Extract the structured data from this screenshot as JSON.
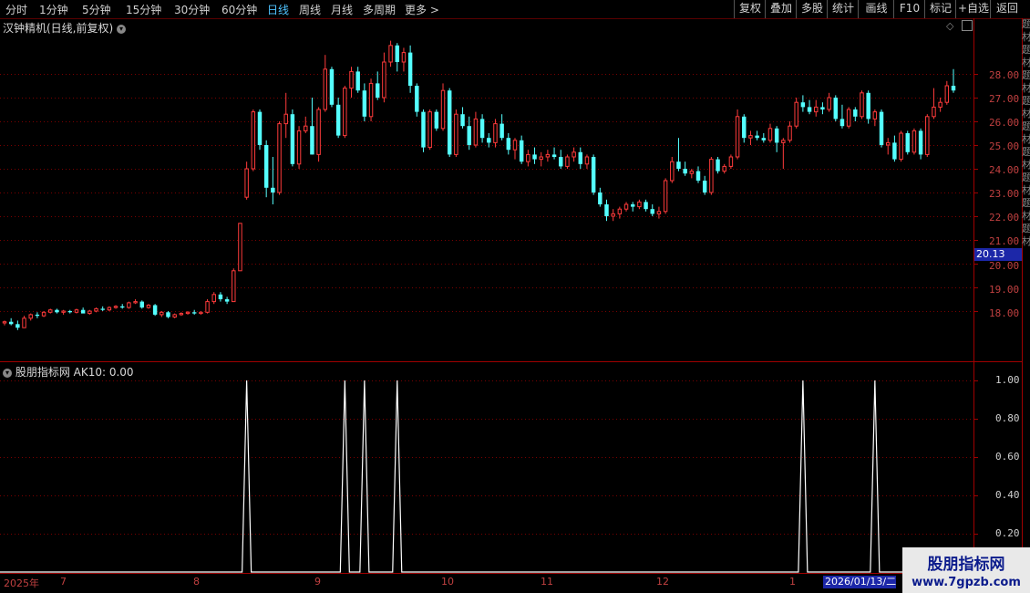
{
  "toolbar": {
    "periods": [
      "分时",
      "1分钟",
      "5分钟",
      "15分钟",
      "30分钟",
      "60分钟",
      "日线",
      "周线",
      "月线",
      "多周期",
      "更多 >"
    ],
    "active_period": "日线",
    "right_buttons": [
      "复权",
      "叠加",
      "多股",
      "统计",
      "画线",
      "F10",
      "标记",
      "+自选",
      "返回"
    ]
  },
  "main_title": "汉钟精机(日线,前复权)",
  "indicator_title": "股朋指标网  AK10: 0.00",
  "price_axis": [
    "28.00",
    "27.00",
    "26.00",
    "25.00",
    "24.00",
    "23.00",
    "22.00",
    "21.00",
    "20.00",
    "19.00",
    "18.00"
  ],
  "indicator_axis": [
    "1.00",
    "0.80",
    "0.60",
    "0.40",
    "0.20"
  ],
  "current_price": "20.13",
  "date_axis": [
    "2025年",
    "7",
    "8",
    "9",
    "10",
    "11",
    "12",
    "1"
  ],
  "cursor_date": "2026/01/13/二",
  "watermark": {
    "name": "股朋指标网",
    "url": "www.7gpzb.com"
  },
  "colors": {
    "up": "#ff3b3b",
    "down": "#54ffff",
    "grid": "#7a0000",
    "line": "#ffffff"
  },
  "side_text": "题材题材题材题材题材题材题材题材题材",
  "chart_data": {
    "type": "candlestick",
    "title": "汉钟精机(日线,前复权)",
    "candles_ohlc": [
      [
        17.5,
        17.6,
        17.4,
        17.55
      ],
      [
        17.55,
        17.7,
        17.4,
        17.45
      ],
      [
        17.45,
        17.6,
        17.2,
        17.3
      ],
      [
        17.3,
        17.8,
        17.3,
        17.7
      ],
      [
        17.7,
        17.9,
        17.6,
        17.85
      ],
      [
        17.85,
        17.95,
        17.7,
        17.8
      ],
      [
        17.8,
        18.0,
        17.75,
        17.95
      ],
      [
        17.95,
        18.1,
        17.9,
        18.05
      ],
      [
        18.05,
        18.1,
        17.9,
        17.95
      ],
      [
        17.95,
        18.05,
        17.85,
        18.0
      ],
      [
        18.0,
        18.05,
        17.9,
        17.95
      ],
      [
        17.95,
        18.1,
        17.9,
        18.05
      ],
      [
        18.05,
        18.15,
        17.95,
        17.9
      ],
      [
        17.9,
        18.05,
        17.85,
        18.0
      ],
      [
        18.0,
        18.15,
        17.95,
        18.1
      ],
      [
        18.1,
        18.2,
        18.0,
        18.05
      ],
      [
        18.05,
        18.2,
        18.0,
        18.15
      ],
      [
        18.15,
        18.25,
        18.1,
        18.2
      ],
      [
        18.2,
        18.3,
        18.1,
        18.15
      ],
      [
        18.15,
        18.4,
        18.1,
        18.35
      ],
      [
        18.35,
        18.5,
        18.3,
        18.4
      ],
      [
        18.4,
        18.45,
        18.1,
        18.15
      ],
      [
        18.15,
        18.3,
        18.1,
        18.25
      ],
      [
        18.25,
        18.3,
        17.8,
        17.85
      ],
      [
        17.85,
        18.0,
        17.75,
        17.95
      ],
      [
        17.95,
        18.0,
        17.7,
        17.75
      ],
      [
        17.75,
        17.9,
        17.7,
        17.85
      ],
      [
        17.85,
        17.95,
        17.8,
        17.9
      ],
      [
        17.9,
        18.0,
        17.85,
        17.95
      ],
      [
        17.95,
        18.05,
        17.85,
        17.9
      ],
      [
        17.9,
        18.0,
        17.85,
        17.95
      ],
      [
        17.95,
        18.5,
        17.9,
        18.4
      ],
      [
        18.4,
        18.8,
        18.3,
        18.7
      ],
      [
        18.7,
        18.8,
        18.4,
        18.5
      ],
      [
        18.5,
        18.6,
        18.3,
        18.4
      ],
      [
        18.4,
        19.8,
        18.4,
        19.7
      ],
      [
        19.7,
        21.7,
        19.7,
        21.7
      ],
      [
        22.8,
        24.3,
        22.7,
        24.0
      ],
      [
        24.0,
        26.5,
        23.9,
        26.4
      ],
      [
        26.4,
        26.5,
        24.8,
        25.0
      ],
      [
        25.0,
        25.2,
        22.8,
        23.2
      ],
      [
        23.2,
        24.5,
        22.5,
        23.0
      ],
      [
        23.0,
        26.0,
        22.9,
        25.9
      ],
      [
        25.9,
        27.2,
        25.3,
        26.3
      ],
      [
        26.3,
        26.5,
        24.1,
        24.2
      ],
      [
        24.2,
        25.8,
        24.0,
        25.6
      ],
      [
        25.6,
        26.2,
        25.5,
        25.8
      ],
      [
        25.8,
        27.0,
        24.6,
        24.6
      ],
      [
        24.6,
        26.6,
        24.3,
        26.5
      ],
      [
        26.5,
        28.8,
        26.4,
        28.2
      ],
      [
        28.2,
        28.3,
        26.6,
        26.7
      ],
      [
        26.7,
        27.0,
        25.3,
        25.4
      ],
      [
        25.4,
        27.5,
        25.3,
        27.4
      ],
      [
        27.4,
        28.3,
        27.0,
        28.1
      ],
      [
        28.1,
        28.3,
        27.2,
        27.3
      ],
      [
        27.3,
        27.6,
        26.0,
        26.2
      ],
      [
        26.2,
        27.8,
        26.0,
        27.6
      ],
      [
        27.6,
        28.1,
        26.9,
        27.0
      ],
      [
        27.0,
        28.9,
        26.8,
        28.5
      ],
      [
        28.5,
        29.4,
        28.3,
        29.2
      ],
      [
        29.2,
        29.3,
        28.1,
        28.5
      ],
      [
        28.5,
        29.1,
        28.1,
        28.9
      ],
      [
        28.9,
        29.2,
        27.2,
        27.5
      ],
      [
        27.5,
        27.6,
        26.2,
        26.4
      ],
      [
        26.4,
        26.5,
        24.7,
        24.9
      ],
      [
        24.9,
        26.5,
        24.8,
        26.4
      ],
      [
        26.4,
        26.5,
        25.6,
        25.7
      ],
      [
        25.7,
        27.6,
        25.6,
        27.3
      ],
      [
        27.3,
        27.4,
        24.5,
        24.6
      ],
      [
        24.6,
        26.5,
        24.5,
        26.3
      ],
      [
        26.3,
        26.6,
        25.7,
        25.8
      ],
      [
        25.8,
        26.2,
        24.8,
        25.0
      ],
      [
        25.0,
        26.4,
        24.9,
        26.1
      ],
      [
        26.1,
        26.3,
        25.1,
        25.3
      ],
      [
        25.3,
        25.5,
        24.9,
        25.1
      ],
      [
        25.1,
        26.1,
        24.9,
        25.9
      ],
      [
        25.9,
        26.3,
        25.2,
        25.3
      ],
      [
        25.3,
        25.5,
        24.6,
        24.8
      ],
      [
        24.8,
        25.3,
        24.4,
        25.2
      ],
      [
        25.2,
        25.4,
        24.2,
        24.3
      ],
      [
        24.3,
        24.8,
        24.1,
        24.6
      ],
      [
        24.6,
        24.9,
        24.2,
        24.4
      ],
      [
        24.4,
        24.7,
        24.1,
        24.5
      ],
      [
        24.5,
        24.8,
        24.3,
        24.6
      ],
      [
        24.6,
        24.9,
        24.4,
        24.5
      ],
      [
        24.5,
        24.8,
        24.0,
        24.1
      ],
      [
        24.1,
        24.6,
        24.0,
        24.5
      ],
      [
        24.5,
        24.9,
        24.3,
        24.7
      ],
      [
        24.7,
        24.9,
        24.0,
        24.2
      ],
      [
        24.2,
        24.6,
        24.0,
        24.5
      ],
      [
        24.5,
        24.6,
        22.9,
        23.0
      ],
      [
        23.0,
        23.2,
        22.4,
        22.5
      ],
      [
        22.5,
        22.7,
        21.8,
        22.0
      ],
      [
        22.0,
        22.3,
        21.8,
        22.1
      ],
      [
        22.1,
        22.4,
        21.9,
        22.3
      ],
      [
        22.3,
        22.6,
        22.2,
        22.5
      ],
      [
        22.5,
        22.6,
        22.2,
        22.4
      ],
      [
        22.4,
        22.7,
        22.3,
        22.6
      ],
      [
        22.6,
        22.7,
        22.2,
        22.3
      ],
      [
        22.3,
        22.5,
        22.0,
        22.1
      ],
      [
        22.1,
        22.4,
        21.9,
        22.2
      ],
      [
        22.2,
        23.6,
        22.1,
        23.5
      ],
      [
        23.5,
        24.5,
        23.4,
        24.3
      ],
      [
        24.3,
        25.3,
        23.9,
        24.0
      ],
      [
        24.0,
        24.3,
        23.7,
        23.8
      ],
      [
        23.8,
        24.0,
        23.6,
        23.9
      ],
      [
        23.9,
        24.1,
        23.4,
        23.5
      ],
      [
        23.5,
        23.7,
        22.9,
        23.0
      ],
      [
        23.0,
        24.5,
        22.9,
        24.4
      ],
      [
        24.4,
        24.5,
        23.8,
        23.9
      ],
      [
        23.9,
        24.2,
        23.8,
        24.1
      ],
      [
        24.1,
        24.6,
        24.0,
        24.5
      ],
      [
        24.5,
        26.5,
        24.4,
        26.2
      ],
      [
        26.2,
        26.3,
        25.1,
        25.3
      ],
      [
        25.3,
        25.6,
        25.0,
        25.4
      ],
      [
        25.4,
        25.6,
        25.2,
        25.3
      ],
      [
        25.3,
        25.5,
        25.1,
        25.2
      ],
      [
        25.2,
        25.9,
        25.1,
        25.7
      ],
      [
        25.7,
        25.8,
        24.7,
        25.1
      ],
      [
        25.1,
        25.3,
        24.0,
        25.2
      ],
      [
        25.2,
        26.0,
        25.1,
        25.8
      ],
      [
        25.8,
        27.0,
        25.7,
        26.8
      ],
      [
        26.8,
        27.1,
        26.4,
        26.6
      ],
      [
        26.6,
        26.9,
        26.3,
        26.4
      ],
      [
        26.4,
        26.9,
        26.2,
        26.6
      ],
      [
        26.6,
        26.8,
        26.3,
        26.5
      ],
      [
        26.5,
        27.2,
        26.4,
        27.0
      ],
      [
        27.0,
        27.1,
        26.0,
        26.1
      ],
      [
        26.1,
        26.7,
        25.7,
        25.8
      ],
      [
        25.8,
        26.6,
        25.7,
        26.5
      ],
      [
        26.5,
        26.6,
        26.0,
        26.2
      ],
      [
        26.2,
        27.3,
        26.1,
        27.2
      ],
      [
        27.2,
        27.3,
        25.9,
        26.1
      ],
      [
        26.1,
        26.5,
        25.8,
        26.4
      ],
      [
        26.4,
        26.5,
        24.9,
        25.0
      ],
      [
        25.0,
        25.3,
        24.6,
        25.1
      ],
      [
        25.1,
        25.4,
        24.3,
        24.4
      ],
      [
        24.4,
        25.6,
        24.3,
        25.5
      ],
      [
        25.5,
        25.6,
        24.6,
        24.7
      ],
      [
        24.7,
        25.7,
        24.6,
        25.6
      ],
      [
        25.6,
        25.7,
        24.4,
        24.6
      ],
      [
        24.6,
        26.3,
        24.5,
        26.2
      ],
      [
        26.2,
        27.4,
        26.1,
        26.6
      ],
      [
        26.6,
        27.0,
        26.4,
        26.8
      ],
      [
        26.8,
        27.7,
        26.7,
        27.5
      ],
      [
        27.5,
        28.2,
        27.2,
        27.3
      ]
    ],
    "indicator": {
      "name": "AK10",
      "value": "0.00",
      "spike_candle_index": [
        37,
        52,
        55,
        60,
        122,
        133
      ],
      "ylim": [
        0,
        1
      ]
    },
    "y_ticks": [
      18,
      19,
      20,
      21,
      22,
      23,
      24,
      25,
      26,
      27,
      28
    ],
    "ylim": [
      16.8,
      29.9
    ]
  }
}
